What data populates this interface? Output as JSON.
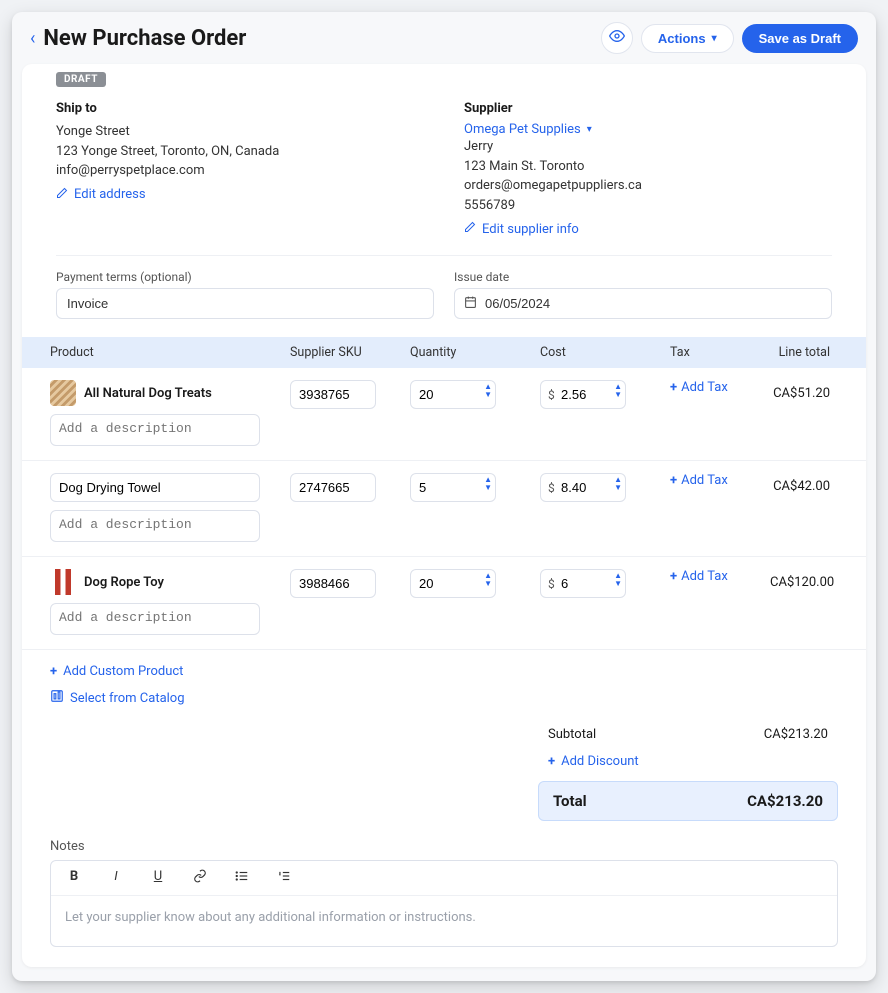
{
  "header": {
    "title": "New Purchase Order",
    "actions_label": "Actions",
    "save_label": "Save as Draft"
  },
  "badge": "DRAFT",
  "ship_to": {
    "label": "Ship to",
    "name": "Yonge Street",
    "address": "123 Yonge Street, Toronto, ON, Canada",
    "email": "info@perryspetplace.com",
    "edit_label": "Edit address"
  },
  "supplier": {
    "label": "Supplier",
    "name": "Omega Pet Supplies",
    "contact": "Jerry",
    "address": "123 Main St. Toronto",
    "email": "orders@omegapetpuppliers.ca",
    "phone": "5556789",
    "edit_label": "Edit supplier info"
  },
  "terms": {
    "label": "Payment terms (optional)",
    "value": "Invoice"
  },
  "issue_date": {
    "label": "Issue date",
    "value": "06/05/2024"
  },
  "columns": {
    "product": "Product",
    "sku": "Supplier SKU",
    "qty": "Quantity",
    "cost": "Cost",
    "tax": "Tax",
    "line_total": "Line total"
  },
  "products": [
    {
      "name": "All Natural Dog Treats",
      "has_thumb": true,
      "thumb_class": "",
      "sku": "3938765",
      "qty": "20",
      "cost": "2.56",
      "line_total": "CA$51.20",
      "name_editable": false
    },
    {
      "name": "Dog Drying Towel",
      "has_thumb": false,
      "thumb_class": "empty",
      "sku": "2747665",
      "qty": "5",
      "cost": "8.40",
      "line_total": "CA$42.00",
      "name_editable": true
    },
    {
      "name": "Dog Rope Toy",
      "has_thumb": true,
      "thumb_class": "rope",
      "sku": "3988466",
      "qty": "20",
      "cost": "6",
      "line_total": "CA$120.00",
      "name_editable": false
    }
  ],
  "desc_placeholder": "Add a description",
  "add_tax_label": "Add Tax",
  "add_custom_label": "Add Custom Product",
  "select_catalog_label": "Select from Catalog",
  "subtotal_label": "Subtotal",
  "subtotal_value": "CA$213.20",
  "add_discount_label": "Add Discount",
  "total_label": "Total",
  "total_value": "CA$213.20",
  "notes_label": "Notes",
  "notes_placeholder": "Let your supplier know about any additional information or instructions."
}
